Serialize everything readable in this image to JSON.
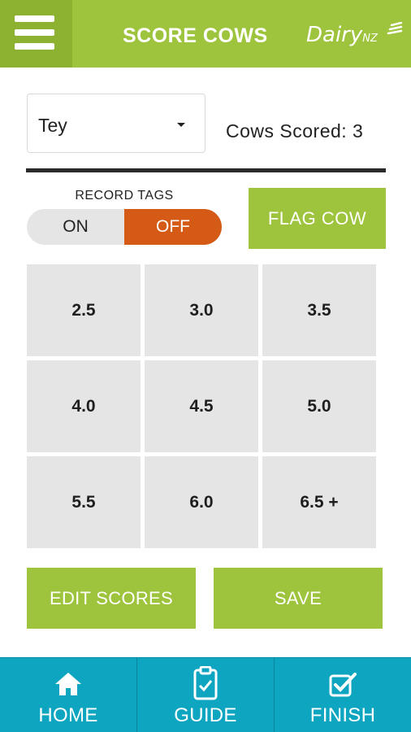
{
  "header": {
    "title": "SCORE COWS",
    "brand_main": "Dairy",
    "brand_suffix": "NZ",
    "menu_icon": "hamburger-menu-icon",
    "color": "#9dc43c"
  },
  "scorer": {
    "selected": "Tey",
    "cows_scored_label": "Cows Scored: 3"
  },
  "record_tags": {
    "label": "RECORD TAGS",
    "on_label": "ON",
    "off_label": "OFF",
    "state": "OFF",
    "active_color": "#d45a15"
  },
  "flag_button": "FLAG COW",
  "scores": [
    "2.5",
    "3.0",
    "3.5",
    "4.0",
    "4.5",
    "5.0",
    "5.5",
    "6.0",
    "6.5 +"
  ],
  "actions": {
    "edit": "EDIT SCORES",
    "save": "SAVE"
  },
  "nav": [
    {
      "label": "HOME",
      "icon": "home-icon"
    },
    {
      "label": "GUIDE",
      "icon": "clipboard-icon"
    },
    {
      "label": "FINISH",
      "icon": "checkbox-icon"
    }
  ]
}
